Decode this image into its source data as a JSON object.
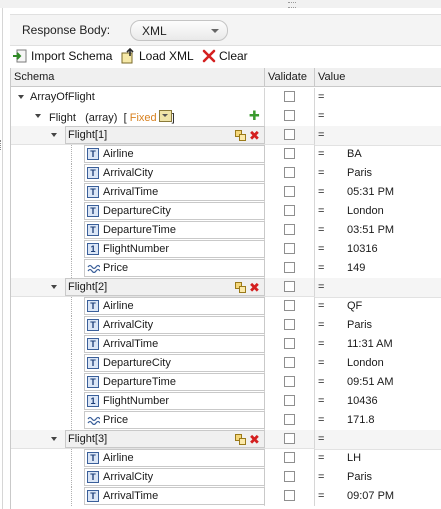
{
  "response": {
    "label": "Response Body:",
    "format_value": "XML"
  },
  "toolbar": {
    "import_schema": "Import Schema",
    "load_xml": "Load XML",
    "clear": "Clear"
  },
  "columns": {
    "schema": "Schema",
    "validate": "Validate",
    "value": "Value"
  },
  "root": {
    "name": "ArrayOfFlight",
    "eq": "="
  },
  "flight": {
    "name": "Flight",
    "type": "(array)",
    "bracket_open": "[",
    "fixed": "Fixed",
    "bracket_close": "]",
    "eq": "="
  },
  "items": [
    {
      "title": "Flight[1]",
      "eq": "=",
      "fields": [
        {
          "name": "Airline",
          "type": "text",
          "eq": "=",
          "value": "BA"
        },
        {
          "name": "ArrivalCity",
          "type": "text",
          "eq": "=",
          "value": "Paris"
        },
        {
          "name": "ArrivalTime",
          "type": "text",
          "eq": "=",
          "value": "05:31 PM"
        },
        {
          "name": "DepartureCity",
          "type": "text",
          "eq": "=",
          "value": "London"
        },
        {
          "name": "DepartureTime",
          "type": "text",
          "eq": "=",
          "value": "03:51 PM"
        },
        {
          "name": "FlightNumber",
          "type": "number",
          "eq": "=",
          "value": "10316"
        },
        {
          "name": "Price",
          "type": "decimal",
          "eq": "=",
          "value": "149"
        }
      ]
    },
    {
      "title": "Flight[2]",
      "eq": "=",
      "fields": [
        {
          "name": "Airline",
          "type": "text",
          "eq": "=",
          "value": "QF"
        },
        {
          "name": "ArrivalCity",
          "type": "text",
          "eq": "=",
          "value": "Paris"
        },
        {
          "name": "ArrivalTime",
          "type": "text",
          "eq": "=",
          "value": "11:31 AM"
        },
        {
          "name": "DepartureCity",
          "type": "text",
          "eq": "=",
          "value": "London"
        },
        {
          "name": "DepartureTime",
          "type": "text",
          "eq": "=",
          "value": "09:51 AM"
        },
        {
          "name": "FlightNumber",
          "type": "number",
          "eq": "=",
          "value": "10436"
        },
        {
          "name": "Price",
          "type": "decimal",
          "eq": "=",
          "value": "171.8"
        }
      ]
    },
    {
      "title": "Flight[3]",
      "eq": "=",
      "fields": [
        {
          "name": "Airline",
          "type": "text",
          "eq": "=",
          "value": "LH"
        },
        {
          "name": "ArrivalCity",
          "type": "text",
          "eq": "=",
          "value": "Paris"
        },
        {
          "name": "ArrivalTime",
          "type": "text",
          "eq": "=",
          "value": "09:07 PM"
        }
      ]
    }
  ],
  "icons": {
    "import": "import-arrow-icon",
    "load": "load-xml-icon",
    "clear": "clear-x-icon",
    "text_type": "text-type-icon",
    "number_type": "number-type-icon",
    "decimal_type": "decimal-type-icon",
    "copy": "copy-icon",
    "delete": "delete-icon",
    "add": "add-icon"
  },
  "colors": {
    "fixed": "#d8811f",
    "delete": "#d42020",
    "add": "#3a9a2e",
    "type_icon": "#3a5f9a"
  }
}
